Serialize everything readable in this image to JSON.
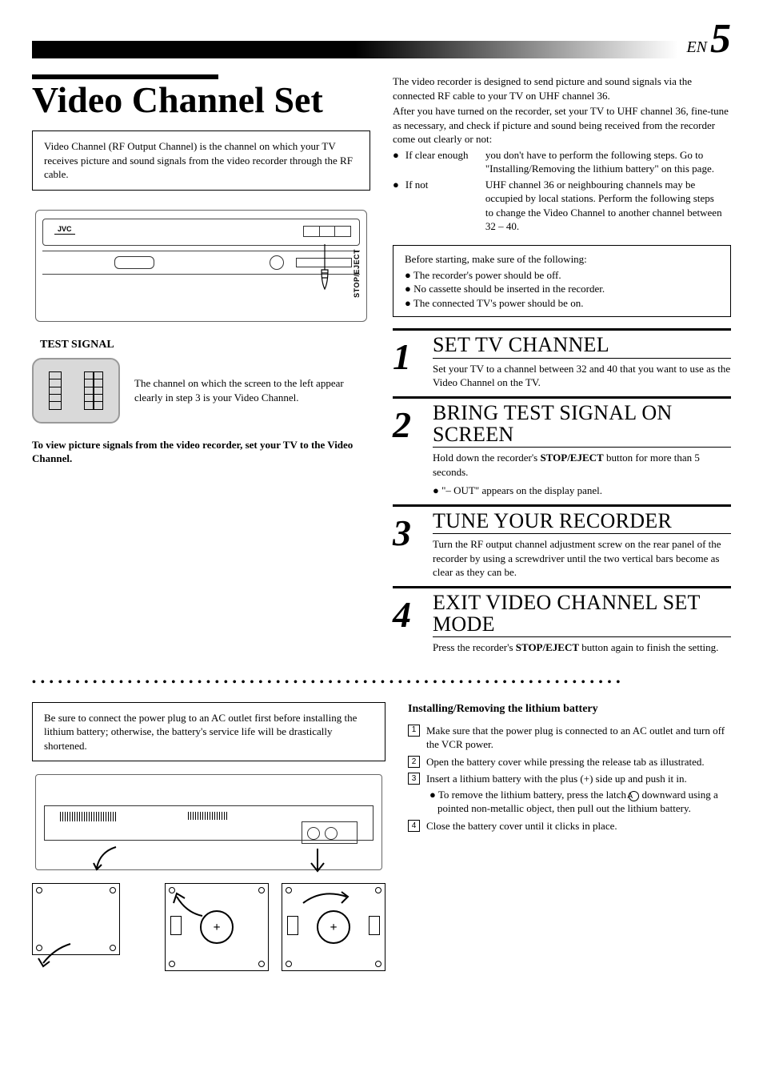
{
  "page": {
    "lang": "EN",
    "number": "5"
  },
  "title": "Video Channel Set",
  "intro_box": "Video Channel (RF Output Channel) is the channel on which your TV receives picture and sound signals from the video recorder through the RF cable.",
  "vcr_label": "STOP/EJECT",
  "vcr_logo": "JVC",
  "test_signal": {
    "heading": "TEST SIGNAL",
    "text": "The channel on which the screen to the left appear clearly in step 3 is your Video Channel."
  },
  "left_bold_note": "To view picture signals from the video recorder, set your TV to the Video Channel.",
  "right_intro_1": "The video recorder is designed to send picture and sound signals via the connected RF cable to your TV on UHF channel 36.",
  "right_intro_2": "After you have turned on the recorder, set your TV to UHF channel 36, fine-tune as necessary, and check if picture and sound being received from the recorder come out clearly or not:",
  "cond": {
    "clear_label": "If clear enough",
    "clear_text": "you don't have to perform the following steps. Go to \"Installing/Removing the lithium battery\" on this page.",
    "not_label": "If not",
    "not_text": "UHF channel 36 or neighbouring channels may be occupied by local stations. Perform the following steps to change the Video Channel to another channel between 32 – 40."
  },
  "prep_box": {
    "lead": "Before starting, make sure of the following:",
    "items": [
      "The recorder's power should be off.",
      "No cassette should be inserted in the recorder.",
      "The connected TV's power should be on."
    ]
  },
  "steps": [
    {
      "num": "1",
      "title": "SET TV CHANNEL",
      "text": "Set your TV to a channel between 32 and 40 that you want to use as the Video Channel on the TV."
    },
    {
      "num": "2",
      "title": "BRING TEST SIGNAL ON SCREEN",
      "text_pre": "Hold down the recorder's ",
      "bold": "STOP/EJECT",
      "text_post": " button for more than 5 seconds.",
      "bullet": "\"– OUT\" appears on the display panel."
    },
    {
      "num": "3",
      "title": "TUNE YOUR RECORDER",
      "text": "Turn the RF output channel adjustment screw on the rear panel of the recorder by using a screwdriver until the two vertical bars become as clear as they can be."
    },
    {
      "num": "4",
      "title": "EXIT VIDEO CHANNEL SET MODE",
      "text_pre": "Press the recorder's ",
      "bold": "STOP/EJECT",
      "text_post": " button again to finish the setting."
    }
  ],
  "battery_warn": "Be sure to connect the power plug to an AC outlet first before installing the lithium battery; otherwise, the battery's service life will be drastically shortened.",
  "battery": {
    "heading": "Installing/Removing the lithium battery",
    "items": [
      "Make sure that the power plug is connected to an AC outlet and turn off the VCR power.",
      "Open the battery cover while pressing the release tab as illustrated.",
      "Insert a lithium battery with the plus (+) side up and push it in.",
      "Close the battery cover until it clicks in place."
    ],
    "sub_bullet_pre": "To remove the lithium battery, press the latch ",
    "sub_bullet_a": "A",
    "sub_bullet_post": " downward using a pointed non-metallic object, then pull out the lithium battery."
  }
}
